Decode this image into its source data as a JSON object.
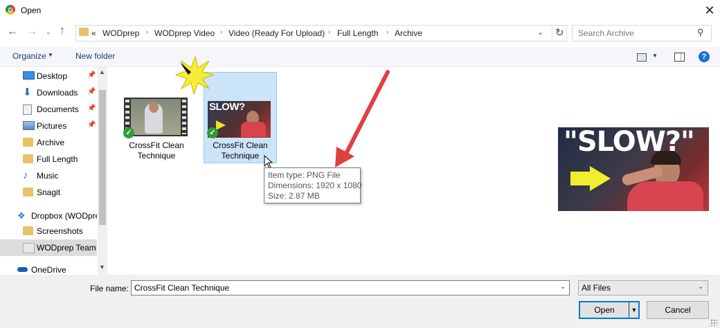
{
  "window": {
    "title": "Open"
  },
  "address": {
    "overflow": "«",
    "crumbs": [
      "WODprep",
      "WODprep Video",
      "Video (Ready For Upload)",
      "Full Length",
      "Archive"
    ]
  },
  "search": {
    "placeholder": "Search Archive"
  },
  "toolbar": {
    "organize": "Organize",
    "new_folder": "New folder"
  },
  "nav": {
    "items": [
      {
        "label": "Desktop",
        "icon": "desktop-icon"
      },
      {
        "label": "Downloads",
        "icon": "download-arrow-icon"
      },
      {
        "label": "Documents",
        "icon": "documents-icon"
      },
      {
        "label": "Pictures",
        "icon": "pictures-icon"
      },
      {
        "label": "Archive",
        "icon": "folder-icon"
      },
      {
        "label": "Full Length",
        "icon": "folder-icon"
      },
      {
        "label": "Music",
        "icon": "music-note-icon"
      },
      {
        "label": "Snagit",
        "icon": "folder-icon"
      },
      {
        "label": "Dropbox (WODpre",
        "icon": "dropbox-icon"
      },
      {
        "label": "Screenshots",
        "icon": "folder-icon"
      },
      {
        "label": "WODprep Team",
        "icon": "folder-icon"
      },
      {
        "label": "OneDrive",
        "icon": "cloud-icon"
      }
    ]
  },
  "files": [
    {
      "name_line1": "CrossFit Clean",
      "name_line2": "Technique",
      "type": "video"
    },
    {
      "name_line1": "CrossFit Clean",
      "name_line2": "Technique",
      "type": "image",
      "thumb_text": "SLOW?"
    }
  ],
  "tooltip": {
    "type": "Item type: PNG File",
    "dimensions": "Dimensions: 1920 x 1080",
    "size": "Size: 2.87 MB"
  },
  "preview": {
    "text": "\"SLOW?\""
  },
  "bottom": {
    "filename_label": "File name:",
    "filename_value": "CrossFit Clean Technique",
    "filter_value": "All Files",
    "open_label": "Open",
    "cancel_label": "Cancel"
  },
  "colors": {
    "accent": "#0078d7",
    "arrow": "#e04040",
    "selection": "#cce4f7"
  }
}
